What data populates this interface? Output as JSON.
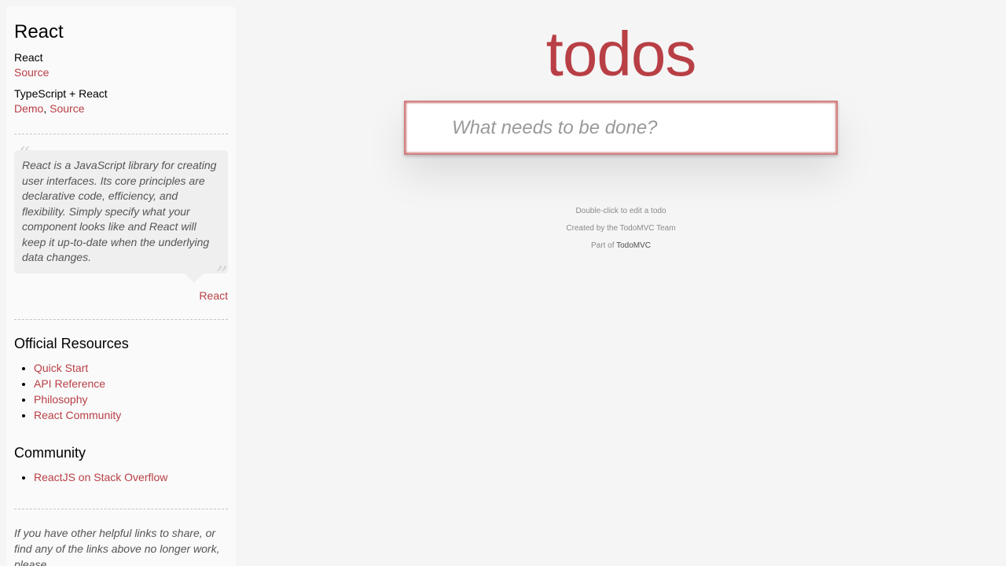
{
  "sidebar": {
    "title": "React",
    "examples": [
      {
        "name": "React",
        "links": [
          "Source"
        ]
      },
      {
        "name": "TypeScript + React",
        "links": [
          "Demo",
          "Source"
        ]
      }
    ],
    "quote": {
      "text": "React is a JavaScript library for creating user interfaces. Its core principles are declarative code, efficiency, and flexibility. Simply specify what your component looks like and React will keep it up-to-date when the underlying data changes.",
      "source": "React"
    },
    "official_resources": {
      "title": "Official Resources",
      "items": [
        "Quick Start",
        "API Reference",
        "Philosophy",
        "React Community"
      ]
    },
    "community": {
      "title": "Community",
      "items": [
        "ReactJS on Stack Overflow"
      ]
    },
    "footer_note": "If you have other helpful links to share, or find any of the links above no longer work, please"
  },
  "app": {
    "title": "todos",
    "new_todo_placeholder": "What needs to be done?"
  },
  "info": {
    "line1": "Double-click to edit a todo",
    "line2": "Created by the TodoMVC Team",
    "line3_prefix": "Part of ",
    "line3_link": "TodoMVC"
  },
  "colors": {
    "accent": "#b83f45",
    "background": "#f5f5f5"
  }
}
